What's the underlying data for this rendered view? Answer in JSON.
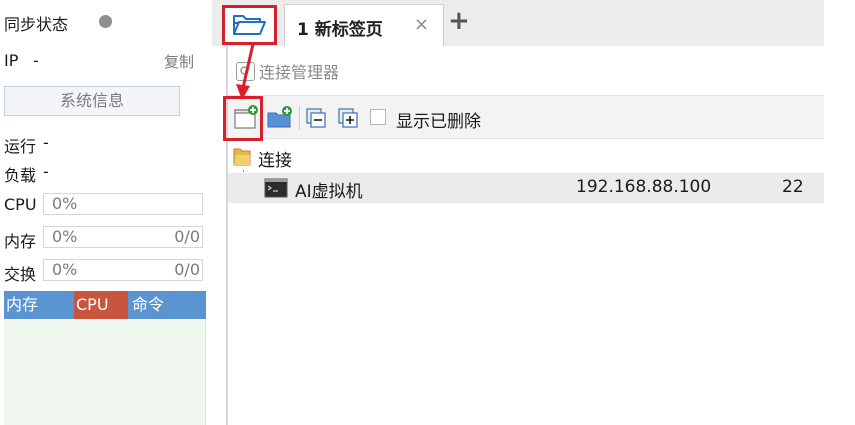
{
  "sidebar": {
    "sync_label": "同步状态",
    "ip_label": "IP",
    "ip_value": "-",
    "copy_label": "复制",
    "system_info_button": "系统信息",
    "run_label": "运行",
    "run_value": "-",
    "load_label": "负载",
    "load_value": "-",
    "cpu": {
      "label": "CPU",
      "percent": "0%"
    },
    "memory": {
      "label": "内存",
      "percent": "0%",
      "ratio": "0/0"
    },
    "swap": {
      "label": "交换",
      "percent": "0%",
      "ratio": "0/0"
    },
    "process_columns": [
      "内存",
      "CPU",
      "命令"
    ],
    "colors": {
      "sync_dot": "#8f8f8f",
      "header_bg": "#5b95d1",
      "cpu_col_bg": "#c8553d"
    }
  },
  "tabs": {
    "active_label": "1 新标签页",
    "close_icon": "×",
    "add_icon": "+"
  },
  "connection_manager": {
    "title": "连接管理器"
  },
  "toolbar": {
    "show_deleted_label": "显示已删除",
    "show_deleted_checked": false
  },
  "tree": {
    "folder_label": "连接",
    "items": [
      {
        "name": "AI虚拟机",
        "host": "192.168.88.100",
        "port": "22"
      }
    ]
  },
  "annotation": {
    "highlight_color": "#d8202c"
  }
}
